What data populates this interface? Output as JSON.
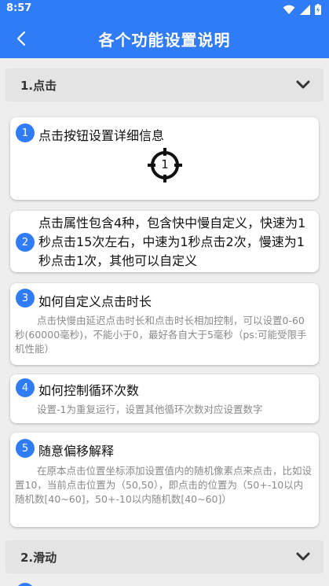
{
  "status_bar": {
    "time": "8:57"
  },
  "app_bar": {
    "title": "各个功能设置说明"
  },
  "sections": [
    {
      "label": "1.点击"
    },
    {
      "label": "2.滑动"
    }
  ],
  "cards": [
    {
      "number": "1",
      "title": "点击按钮设置详细信息",
      "target_number": "1"
    },
    {
      "number": "2",
      "text": "点击属性包含4种，包含快中慢自定义，快速为1秒点击15次左右，中速为1秒点击2次，慢速为1秒点击1次，其他可以自定义"
    },
    {
      "number": "3",
      "title": "如何自定义点击时长",
      "desc": "点击快慢由延迟点击时长和点击时长相加控制，可以设置0-60秒(60000毫秒)，不能小于0，最好各自大于5毫秒（ps:可能受限手机性能）"
    },
    {
      "number": "4",
      "title": "如何控制循环次数",
      "desc": "设置-1为重复运行，设置其他循环次数对应设置数字"
    },
    {
      "number": "5",
      "title": "随意偏移解释",
      "desc": "在原本点击位置坐标添加设置值内的随机像素点来点击，比如设置10，当前点击位置为（50,50），即点击的位置为（50+-10以内随机数[40~60]，50+-10以内随机数[40~60]）"
    }
  ],
  "colors": {
    "primary": "#2f7cf6",
    "background": "#eeeeee",
    "section": "#e4e4e4",
    "desc_text": "#8a8a8a"
  }
}
